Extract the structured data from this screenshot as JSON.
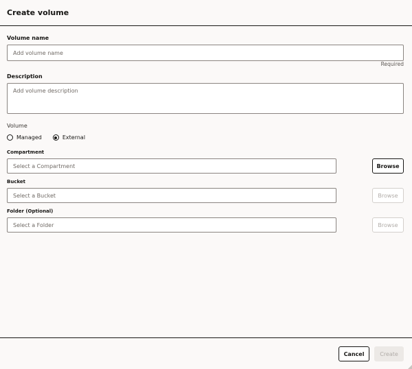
{
  "dialog": {
    "title": "Create volume"
  },
  "volume_name": {
    "label": "Volume name",
    "placeholder": "Add volume name",
    "value": "",
    "required_text": "Required"
  },
  "description": {
    "label": "Description",
    "placeholder": "Add volume description",
    "value": ""
  },
  "volume_type": {
    "label": "Volume",
    "options": [
      {
        "label": "Managed",
        "selected": false
      },
      {
        "label": "External",
        "selected": true
      }
    ]
  },
  "compartment": {
    "label": "Compartment",
    "placeholder": "Select a Compartment",
    "browse_label": "Browse",
    "browse_enabled": true
  },
  "bucket": {
    "label": "Bucket",
    "placeholder": "Select a Bucket",
    "browse_label": "Browse",
    "browse_enabled": false
  },
  "folder": {
    "label": "Folder (Optional)",
    "placeholder": "Select a Folder",
    "browse_label": "Browse",
    "browse_enabled": false
  },
  "footer": {
    "cancel_label": "Cancel",
    "create_label": "Create",
    "create_enabled": false
  }
}
